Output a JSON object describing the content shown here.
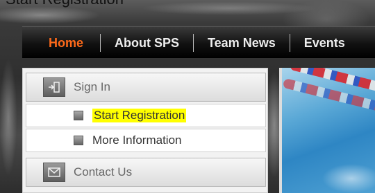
{
  "header": {
    "clipped_title": "Start Registration"
  },
  "nav": {
    "items": [
      {
        "label": "Home",
        "active": true
      },
      {
        "label": "About SPS",
        "active": false
      },
      {
        "label": "Team News",
        "active": false
      },
      {
        "label": "Events",
        "active": false
      }
    ]
  },
  "menu": {
    "sign_in": {
      "label": "Sign In",
      "icon": "exit-door-icon"
    },
    "sub_items": [
      {
        "label": "Start Registration",
        "highlighted": true,
        "icon": "square-bullet-icon"
      },
      {
        "label": "More Information",
        "highlighted": false,
        "icon": "square-bullet-icon"
      }
    ],
    "contact": {
      "label": "Contact Us",
      "icon": "envelope-icon"
    }
  },
  "colors": {
    "nav_active": "#ff6a1a",
    "highlight": "#ffff00"
  }
}
